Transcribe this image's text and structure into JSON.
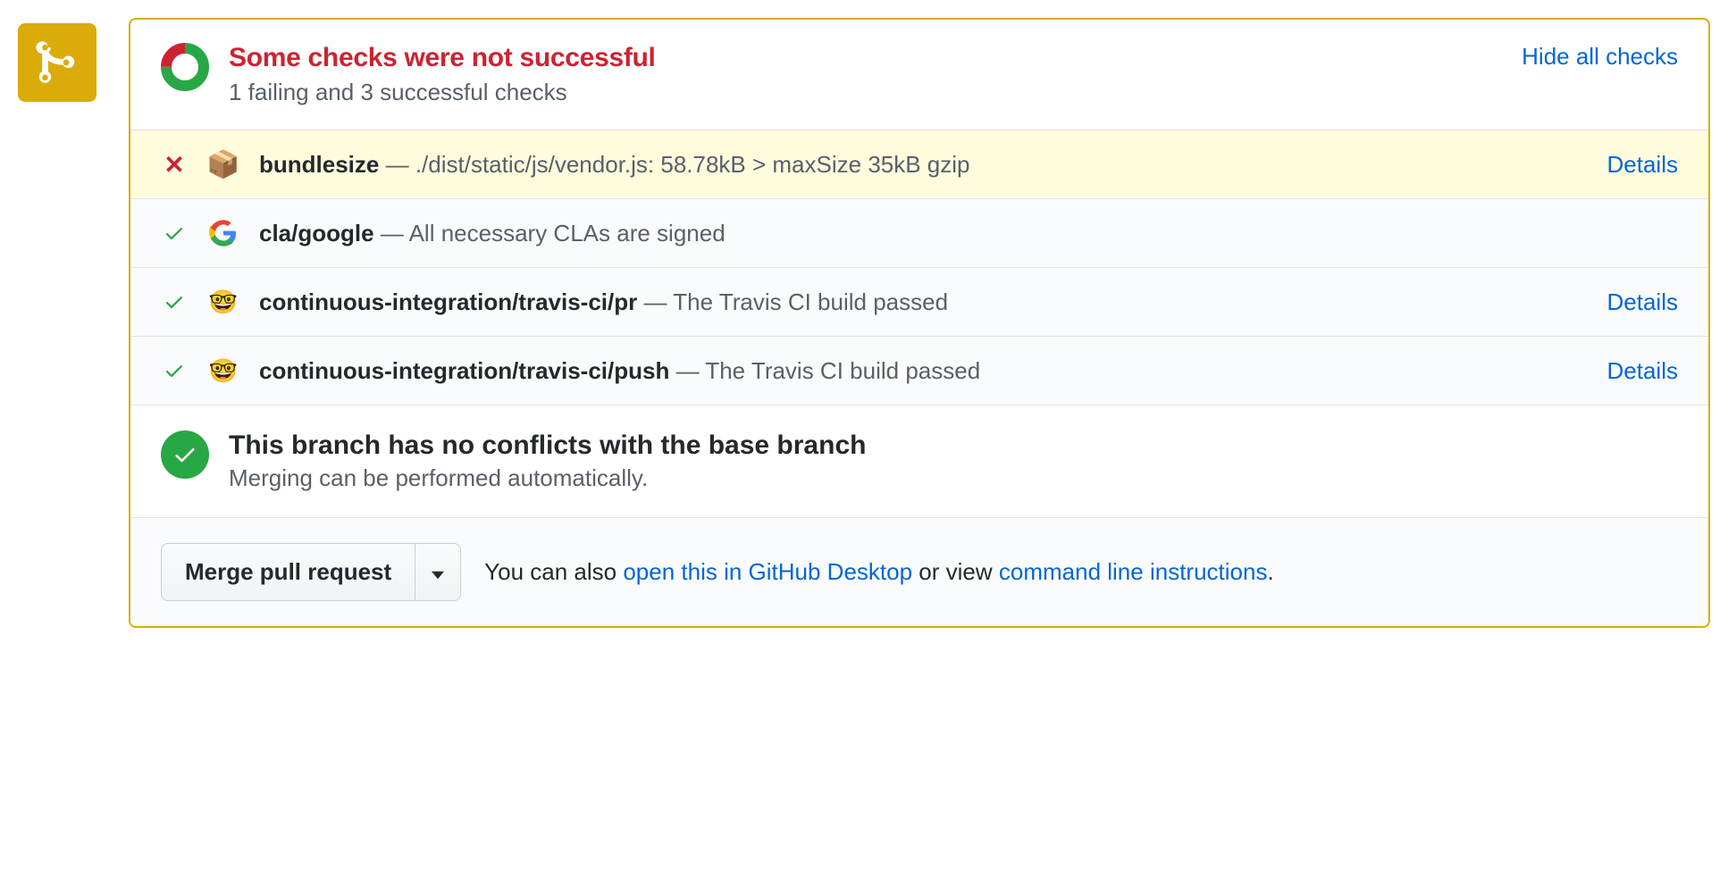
{
  "status": {
    "title": "Some checks were not successful",
    "subtitle": "1 failing and 3 successful checks",
    "hide_link": "Hide all checks",
    "success_count": 3,
    "fail_count": 1
  },
  "checks": [
    {
      "state": "fail",
      "icon": "package",
      "name": "bundlesize",
      "desc": "./dist/static/js/vendor.js: 58.78kB > maxSize 35kB gzip",
      "details": "Details"
    },
    {
      "state": "pass",
      "icon": "google",
      "name": "cla/google",
      "desc": "All necessary CLAs are signed",
      "details": ""
    },
    {
      "state": "pass",
      "icon": "travis",
      "name": "continuous-integration/travis-ci/pr",
      "desc": "The Travis CI build passed",
      "details": "Details"
    },
    {
      "state": "pass",
      "icon": "travis",
      "name": "continuous-integration/travis-ci/push",
      "desc": "The Travis CI build passed",
      "details": "Details"
    }
  ],
  "merge": {
    "title": "This branch has no conflicts with the base branch",
    "subtitle": "Merging can be performed automatically."
  },
  "footer": {
    "button": "Merge pull request",
    "prefix": "You can also ",
    "link1": "open this in GitHub Desktop",
    "mid": " or view ",
    "link2": "command line instructions",
    "suffix": "."
  }
}
